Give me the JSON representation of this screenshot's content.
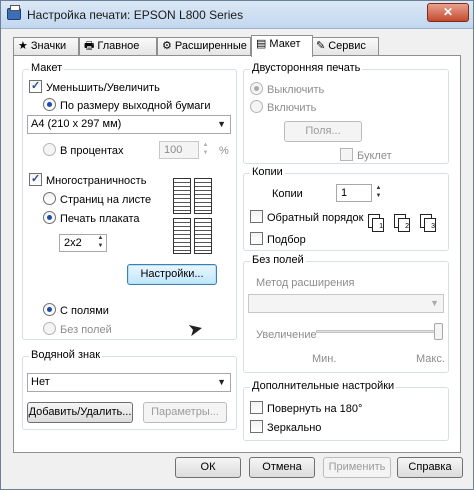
{
  "window": {
    "title": "Настройка печати: EPSON L800 Series",
    "close": "✕"
  },
  "tabs": [
    {
      "label": "Значки",
      "icon": "star-icon"
    },
    {
      "label": "Главное",
      "icon": "printer-icon"
    },
    {
      "label": "Расширенные",
      "icon": "settings-icon"
    },
    {
      "label": "Макет",
      "icon": "page-icon"
    },
    {
      "label": "Сервис",
      "icon": "wrench-icon"
    }
  ],
  "layout": {
    "label": "Макет",
    "reduce_enlarge": "Уменьшить/Увеличить",
    "fit_to_paper": "По размеру выходной бумаги",
    "paper_size": "A4 (210 x 297 мм)",
    "percent": "В процентах",
    "percent_value": "100",
    "percent_unit": "%",
    "multipage": "Многостраничность",
    "pages_per_sheet": "Страниц на листе",
    "poster_print": "Печать плаката",
    "poster_size": "2x2",
    "settings_button": "Настройки...",
    "with_margins": "С полями",
    "borderless": "Без полей"
  },
  "watermark": {
    "label": "Водяной знак",
    "value": "Нет",
    "add_remove": "Добавить/Удалить...",
    "parameters": "Параметры..."
  },
  "duplex": {
    "label": "Двусторонняя печать",
    "off": "Выключить",
    "on": "Включить",
    "margins_button": "Поля...",
    "booklet": "Буклет"
  },
  "copies": {
    "label": "Копии",
    "copies_label": "Копии",
    "copies_value": "1",
    "reverse_order": "Обратный порядок",
    "collate": "Подбор"
  },
  "borderless_group": {
    "label": "Без полей",
    "expansion_method": "Метод расширения",
    "increase": "Увеличение",
    "min": "Мин.",
    "max": "Макс.",
    "expansion_level": 1.0
  },
  "extra": {
    "label": "Дополнительные настройки",
    "rotate": "Повернуть на  180°",
    "mirror": "Зеркально"
  },
  "footer": {
    "ok": "ОК",
    "cancel": "Отмена",
    "apply": "Применить",
    "help": "Справка"
  }
}
